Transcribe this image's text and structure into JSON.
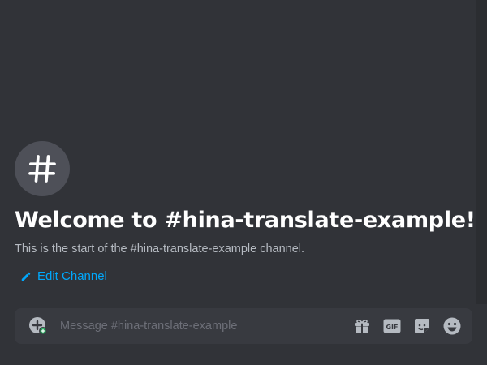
{
  "welcome": {
    "title": "Welcome to #hina-translate-example!",
    "subtitle": "This is the start of the #hina-translate-example channel.",
    "edit_label": "Edit Channel"
  },
  "composer": {
    "placeholder": "Message #hina-translate-example"
  },
  "icons": {
    "channel": "hashtag-icon",
    "edit": "pencil-icon",
    "attach": "plus-circle-icon",
    "gift": "gift-icon",
    "gif": "gif-icon",
    "sticker": "sticker-icon",
    "emoji": "emoji-icon"
  },
  "colors": {
    "background": "#313338",
    "composer": "#383a40",
    "link": "#00a8fc",
    "title": "#ffffff",
    "muted": "#b5bac1",
    "icon": "#b5bac1",
    "badge": "#23a55a"
  }
}
